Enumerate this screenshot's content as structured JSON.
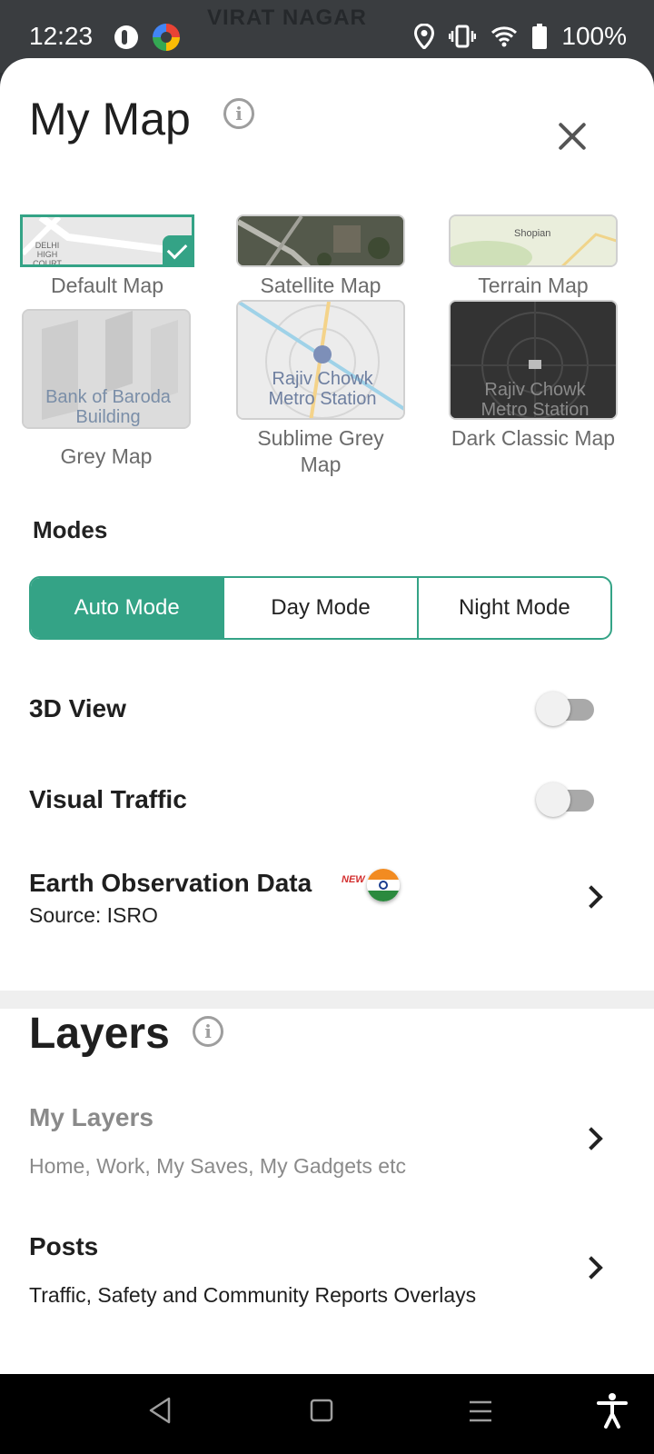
{
  "status_bar": {
    "time": "12:23",
    "map_background_text": "VIRAT NAGAR",
    "battery": "100%",
    "icons": [
      "location-icon",
      "vibrate-icon",
      "wifi-icon",
      "battery-icon"
    ]
  },
  "sheet": {
    "title": "My Map",
    "close_icon": "close-icon",
    "info_icon": "info-icon"
  },
  "map_styles": [
    {
      "label": "Default Map",
      "selected": true,
      "tile_text": "DELHI HIGH COURT"
    },
    {
      "label": "Satellite Map",
      "selected": false
    },
    {
      "label": "Terrain Map",
      "selected": false,
      "tile_text": "Shopian"
    },
    {
      "label": "Grey Map",
      "selected": false,
      "tile_text": "Bank of Baroda Building"
    },
    {
      "label": "Sublime Grey Map",
      "selected": false,
      "tile_text": "Rajiv Chowk Metro Station"
    },
    {
      "label": "Dark Classic Map",
      "selected": false,
      "tile_text": "Rajiv Chowk Metro Station"
    }
  ],
  "modes": {
    "heading": "Modes",
    "options": [
      "Auto Mode",
      "Day Mode",
      "Night Mode"
    ],
    "selected": "Auto Mode"
  },
  "settings": {
    "view_3d": {
      "label": "3D View",
      "enabled": false
    },
    "visual_traffic": {
      "label": "Visual Traffic",
      "enabled": false
    },
    "earth_observation": {
      "label": "Earth Observation Data",
      "badge": "NEW",
      "source": "Source: ISRO"
    }
  },
  "layers": {
    "title": "Layers",
    "my_layers": {
      "title": "My Layers",
      "subtitle": "Home, Work, My Saves, My Gadgets etc"
    },
    "posts": {
      "title": "Posts",
      "subtitle": "Traffic, Safety and Community Reports Overlays"
    }
  },
  "colors": {
    "accent": "#34a386",
    "text": "#1f1f1f",
    "muted": "#8a8a8a"
  }
}
